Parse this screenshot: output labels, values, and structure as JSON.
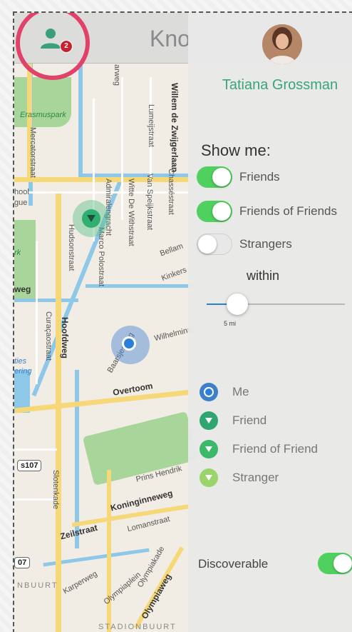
{
  "nav": {
    "title": "Kno",
    "friend_request_count": "2"
  },
  "map_labels": {
    "park": "Erasmuspark",
    "mercatorstraat": "Mercatorstraat",
    "school": "hool",
    "gue": "gue",
    "rk": "rk",
    "weg": "weg",
    "hudsonstraat": "Hudsonstraat",
    "admiralengracht": "Admiralengracht",
    "witte": "Witte De Withstraat",
    "van_speijk": "Van Speijkstraat",
    "chasse": "Chasséstraat",
    "lumeij": "Lumeijstraat",
    "zwijger": "Willem de Zwijgerlaan",
    "polo": "Marco Polostraat",
    "bellamy": "Bellam",
    "kinkers": "Kinkers",
    "curacao": "Curaçaostraat",
    "hoofdweg": "Hoofdweg",
    "baarsjesweg": "Baarsjesweg",
    "wilhelmina": "Wilhelmina",
    "overtoom": "Overtoom",
    "ties": "ties",
    "ering": "ering",
    "s107": "s107",
    "slotenkade": "Slotenkade",
    "prins": "Prins Hendrik",
    "koninginne": "Koninginneweg",
    "lomanstraat": "Lomanstraat",
    "zeilstraat": "Zeilstraat",
    "n07": "07",
    "nbuurt": "NBUURT",
    "karperweg": "Karperweg",
    "olympiaplein": "Olympiaplein",
    "olympiaweg": "Olympiaweg",
    "olympiakade": "Olympiakade",
    "stadionbuurt": "STADIONBUURT",
    "arweg": "arweg"
  },
  "panel": {
    "user_name": "Tatiana Grossman",
    "show_me_label": "Show me:",
    "options": [
      {
        "label": "Friends",
        "on": true
      },
      {
        "label": "Friends of Friends",
        "on": true
      },
      {
        "label": "Strangers",
        "on": false
      }
    ],
    "within_label": "within",
    "distance": {
      "value_label": "5 mi",
      "fraction": 0.22
    },
    "legend": [
      {
        "label": "Me",
        "color": "#3d7fc9"
      },
      {
        "label": "Friend",
        "color": "#2fa572"
      },
      {
        "label": "Friend of Friend",
        "color": "#3cb86a"
      },
      {
        "label": "Stranger",
        "color": "#9ad46b"
      }
    ],
    "discoverable_label": "Discoverable",
    "discoverable_on": true
  },
  "colors": {
    "accent_green": "#3aa578",
    "switch_on": "#4fd05f",
    "me_blue": "#2b7fd9",
    "highlight_ring": "#e0426a",
    "badge_red": "#c9202f"
  }
}
